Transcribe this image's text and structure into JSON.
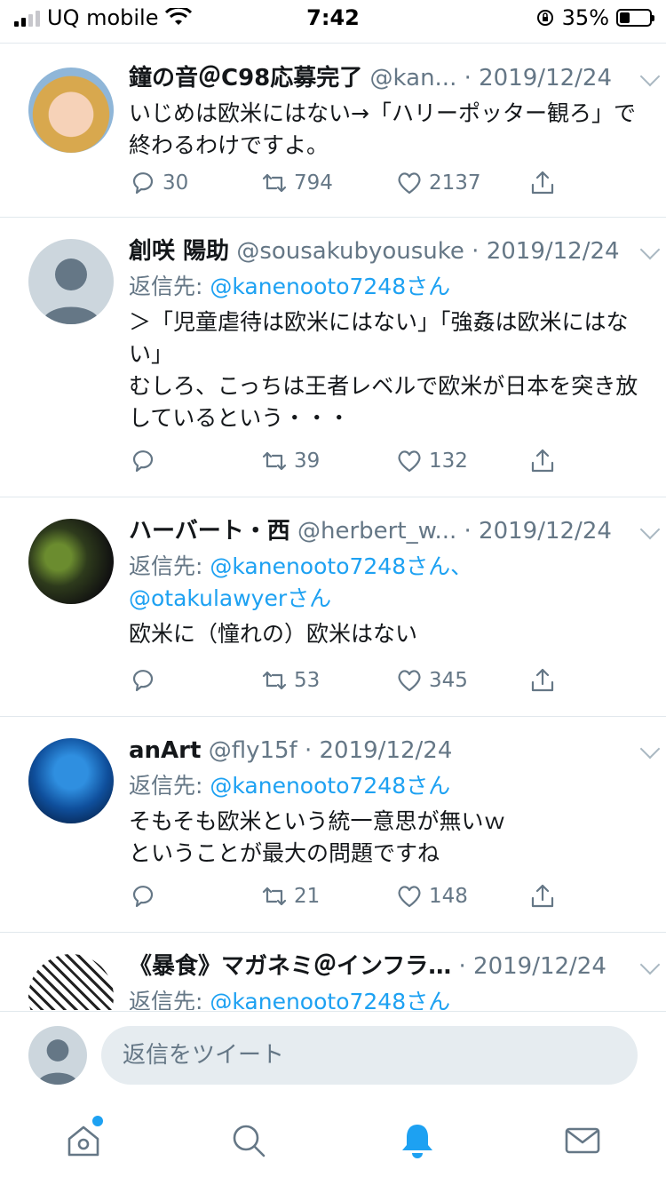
{
  "status_bar": {
    "carrier": "UQ mobile",
    "time": "7:42",
    "battery": "35%",
    "battery_level": 0.35
  },
  "tweets": [
    {
      "name": "鐘の音＠C98応募完了",
      "handle": "@kan...",
      "date": "· 2019/12/24",
      "reply_prefix": "",
      "reply_to": "",
      "reply_to_2": "",
      "text": "いじめは欧米にはない→「ハリーポッター観ろ」で終わるわけですよ。",
      "replies": "30",
      "retweets": "794",
      "likes": "2137"
    },
    {
      "name": "創咲 陽助",
      "handle": "@sousakubyousuke",
      "date": "· 2019/12/24",
      "reply_prefix": "返信先: ",
      "reply_to": "@kanenooto7248さん",
      "reply_to_2": "",
      "text": "＞「児童虐待は欧米にはない」「強姦は欧米にはない」\nむしろ、こっちは王者レベルで欧米が日本を突き放しているという・・・",
      "replies": "",
      "retweets": "39",
      "likes": "132"
    },
    {
      "name": "ハーバート・西",
      "handle": "@herbert_w...",
      "date": "· 2019/12/24",
      "reply_prefix": "返信先: ",
      "reply_to": "@kanenooto7248さん、",
      "reply_to_2": "@otakulawyerさん",
      "text": "欧米に（憧れの）欧米はない",
      "replies": "",
      "retweets": "53",
      "likes": "345"
    },
    {
      "name": "anArt",
      "handle": "@fly15f",
      "date": "· 2019/12/24",
      "reply_prefix": "返信先: ",
      "reply_to": "@kanenooto7248さん",
      "reply_to_2": "",
      "text": "そもそも欧米という統一意思が無いｗ\nということが最大の問題ですね",
      "replies": "",
      "retweets": "21",
      "likes": "148"
    },
    {
      "name": "《暴食》マガネミ＠インフラ…",
      "handle": "",
      "date": "· 2019/12/24",
      "reply_prefix": "返信先: ",
      "reply_to": "@kanenooto7248さん",
      "reply_to_2": "",
      "text": "",
      "replies": "",
      "retweets": "",
      "likes": ""
    }
  ],
  "composer": {
    "placeholder": "返信をツイート"
  },
  "tabs": [
    "home-icon",
    "search-icon",
    "notifications-icon",
    "messages-icon"
  ],
  "colors": {
    "accent": "#1da1f2",
    "text": "#14171a",
    "secondary": "#657786",
    "divider": "#e1e8ed"
  }
}
